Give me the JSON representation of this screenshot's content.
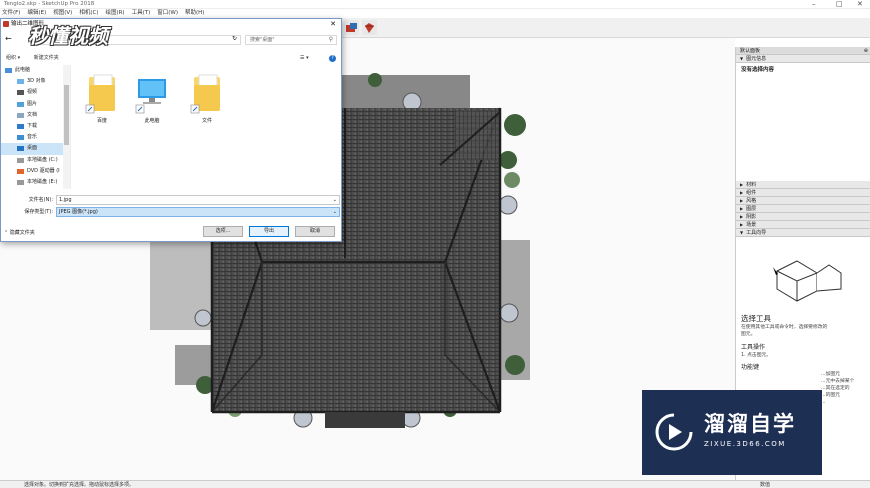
{
  "app": {
    "title": "Tenglo2.skp - SketchUp Pro 2018",
    "menus": [
      "文件(F)",
      "编辑(E)",
      "视图(V)",
      "相机(C)",
      "绘图(R)",
      "工具(T)",
      "窗口(W)",
      "帮助(H)"
    ]
  },
  "dialog": {
    "title": "输出二维图形",
    "search_placeholder": "搜索\"桌面\"",
    "organize": "组织 ▾",
    "new_folder": "新建文件夹",
    "tree": [
      {
        "label": "此电脑"
      },
      {
        "label": "3D 对象"
      },
      {
        "label": "视频"
      },
      {
        "label": "图片"
      },
      {
        "label": "文档"
      },
      {
        "label": "下载"
      },
      {
        "label": "音乐"
      },
      {
        "label": "桌面"
      },
      {
        "label": "本地磁盘 (C:)"
      },
      {
        "label": "DVD 驱动器 (I"
      },
      {
        "label": "本地磁盘 (E:)"
      }
    ],
    "files": [
      {
        "name": "百度"
      },
      {
        "name": "此电脑"
      },
      {
        "name": "文件"
      }
    ],
    "filename_label": "文件名(N):",
    "filename_value": "1.jpg",
    "filetype_label": "保存类型(T):",
    "filetype_value": "JPEG 图像(*.jpg)",
    "hide_folders": "隐藏文件夹",
    "options_button": "选项...",
    "export_button": "导出",
    "cancel_button": "取消"
  },
  "tray": {
    "title": "默认面板",
    "entity_info": "图元信息",
    "no_selection": "没有选择内容",
    "sections": [
      "材料",
      "组件",
      "风格",
      "图层",
      "阴影",
      "场景",
      "工具向导"
    ],
    "tool_title": "选择工具",
    "tool_desc": "在使用其他工具或命令时，选择要修改的图元。",
    "op_title": "工具操作",
    "op_desc": "1. 点击图元。",
    "func_title": "功能键",
    "func_lines": [
      "...加图元",
      "...元中去掉某个",
      "...其在选定的",
      "...的图元",
      "..."
    ]
  },
  "status": {
    "left": "选择对象。切换到扩充选择。拖动鼠标选择多项。",
    "measure_label": "数值"
  },
  "watermark": {
    "logo_text": "秒懂视频",
    "brand_name": "溜溜自学",
    "brand_url": "ZIXUE.3D66.COM"
  }
}
